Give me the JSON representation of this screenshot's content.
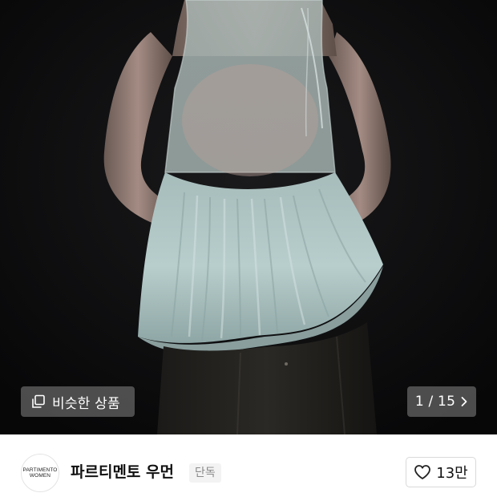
{
  "photo": {
    "alt": "product-photo",
    "similar_button": {
      "icon": "stacked-squares-icon",
      "label": "비슷한 상품"
    },
    "counter": {
      "text": "1 / 15",
      "icon": "chevron-right-icon"
    }
  },
  "shop": {
    "logo_line1": "PARTIMENTO",
    "logo_line2": "WOMEN",
    "name": "파르티멘토 우먼",
    "badge": "단독"
  },
  "like": {
    "icon": "heart-outline-icon",
    "count": "13만"
  },
  "colors": {
    "photo_background": "#0c0c0d",
    "overlay_pill": "#787878",
    "badge_background": "#f3f3f3",
    "badge_text": "#8a8a8a"
  }
}
